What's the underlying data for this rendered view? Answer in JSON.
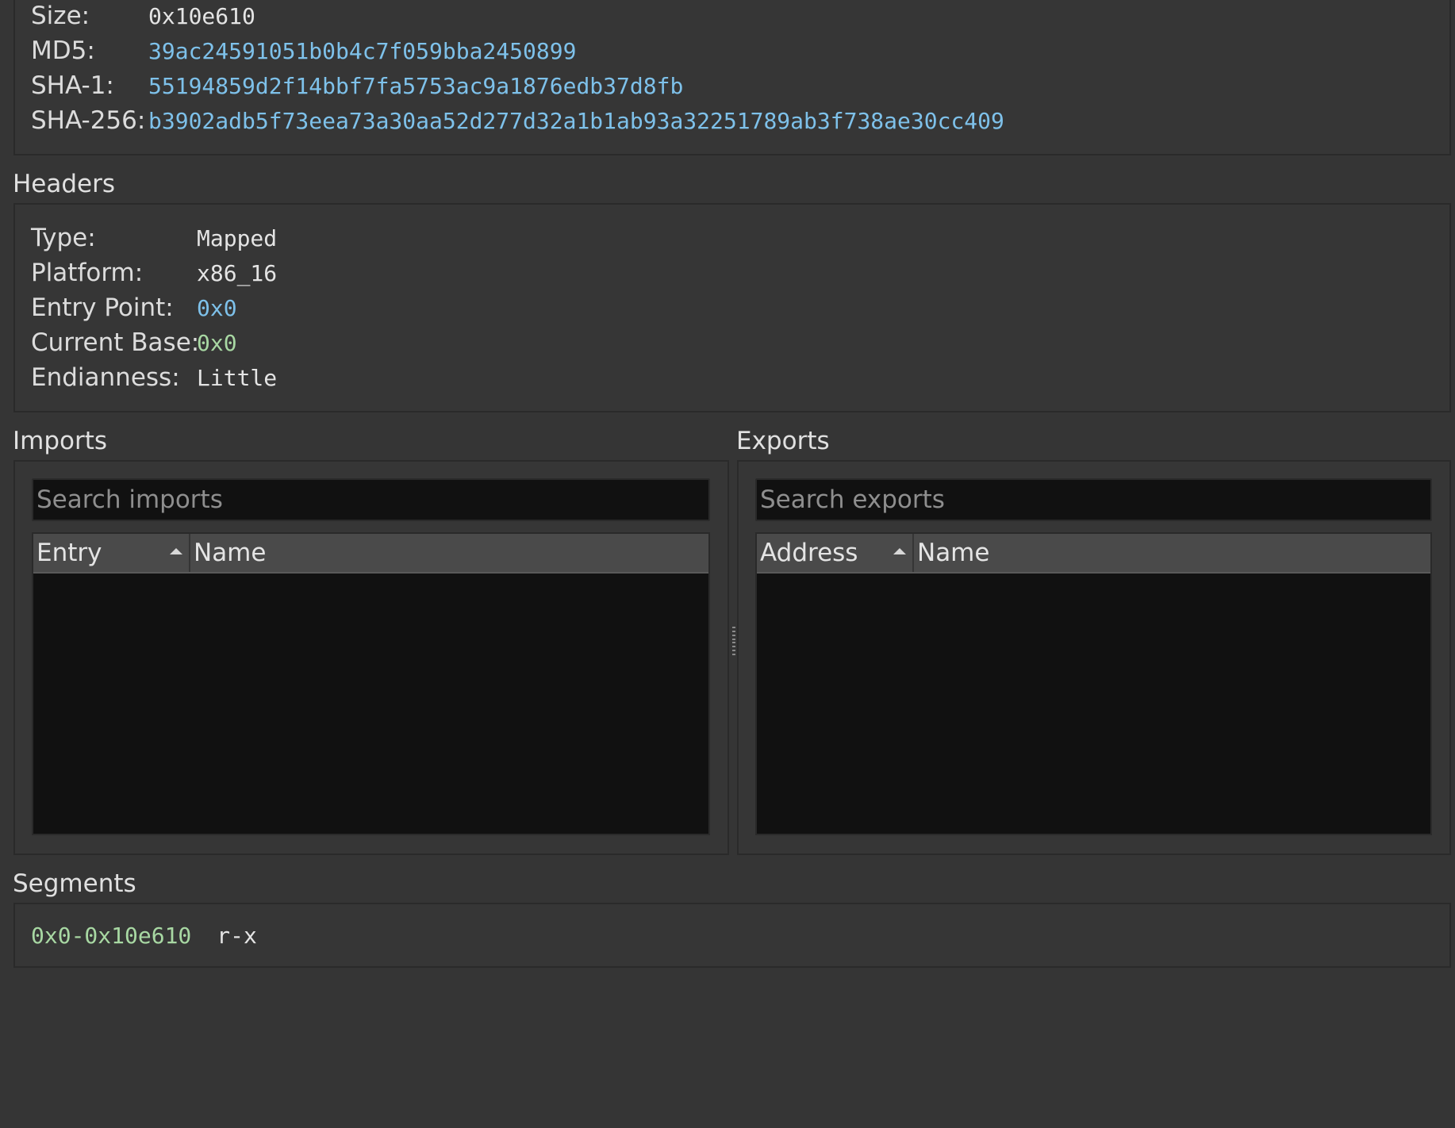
{
  "file_info": {
    "size_label": "Size:",
    "size_value": "0x10e610",
    "md5_label": "MD5:",
    "md5_value": "39ac24591051b0b4c7f059bba2450899",
    "sha1_label": "SHA-1:",
    "sha1_value": "55194859d2f14bbf7fa5753ac9a1876edb37d8fb",
    "sha256_label": "SHA-256:",
    "sha256_value": "b3902adb5f73eea73a30aa52d277d32a1b1ab93a32251789ab3f738ae30cc409"
  },
  "headers": {
    "title": "Headers",
    "type_label": "Type:",
    "type_value": "Mapped",
    "platform_label": "Platform:",
    "platform_value": "x86_16",
    "entry_label": "Entry Point:",
    "entry_value": "0x0",
    "base_label": "Current Base:",
    "base_value": "0x0",
    "endian_label": "Endianness:",
    "endian_value": "Little"
  },
  "imports": {
    "title": "Imports",
    "search_placeholder": "Search imports",
    "col_entry": "Entry",
    "col_name": "Name",
    "rows": []
  },
  "exports": {
    "title": "Exports",
    "search_placeholder": "Search exports",
    "col_address": "Address",
    "col_name": "Name",
    "rows": []
  },
  "segments": {
    "title": "Segments",
    "range": "0x0-0x10e610",
    "perms": "r-x"
  },
  "colors": {
    "background": "#353535",
    "address_blue": "#7ec1ea",
    "address_green": "#a8d8a3",
    "table_bg": "#111111",
    "header_bg": "#4a4a4a"
  }
}
